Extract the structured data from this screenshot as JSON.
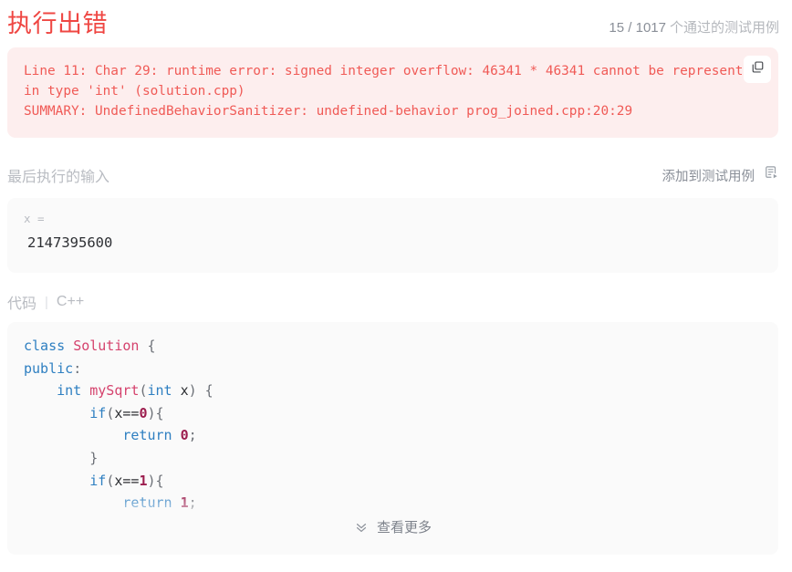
{
  "header": {
    "status_title": "执行出错",
    "passed_count": "15 / 1017",
    "testcase_suffix": "个通过的测试用例"
  },
  "error_panel": {
    "message": "Line 11: Char 29: runtime error: signed integer overflow: 46341 * 46341 cannot be represented in type 'int' (solution.cpp)\nSUMMARY: UndefinedBehaviorSanitizer: undefined-behavior prog_joined.cpp:20:29",
    "copy_icon": "copy-icon",
    "background_color": "#fdeeee",
    "text_color": "#f05a56"
  },
  "input_section": {
    "label": "最后执行的输入",
    "add_testcase_label": "添加到测试用例",
    "add_testcase_icon": "add-to-testcase-icon",
    "variable_name": "x =",
    "variable_value": "2147395600"
  },
  "code_section": {
    "label": "代码",
    "divider": "|",
    "language": "C++",
    "lines": [
      [
        {
          "t": "class ",
          "c": "tok-kw"
        },
        {
          "t": "Solution ",
          "c": "tok-cls"
        },
        {
          "t": "{",
          "c": "tok-punc"
        }
      ],
      [
        {
          "t": "public",
          "c": "tok-kw"
        },
        {
          "t": ":",
          "c": "tok-punc"
        }
      ],
      [
        {
          "t": "    ",
          "c": "tok-id"
        },
        {
          "t": "int ",
          "c": "tok-type"
        },
        {
          "t": "mySqrt",
          "c": "tok-fn"
        },
        {
          "t": "(",
          "c": "tok-punc"
        },
        {
          "t": "int ",
          "c": "tok-type"
        },
        {
          "t": "x",
          "c": "tok-id"
        },
        {
          "t": ") {",
          "c": "tok-punc"
        }
      ],
      [
        {
          "t": "        ",
          "c": "tok-id"
        },
        {
          "t": "if",
          "c": "tok-kw"
        },
        {
          "t": "(",
          "c": "tok-punc"
        },
        {
          "t": "x==",
          "c": "tok-id"
        },
        {
          "t": "0",
          "c": "tok-num"
        },
        {
          "t": "){",
          "c": "tok-punc"
        }
      ],
      [
        {
          "t": "            ",
          "c": "tok-id"
        },
        {
          "t": "return ",
          "c": "tok-kw"
        },
        {
          "t": "0",
          "c": "tok-num"
        },
        {
          "t": ";",
          "c": "tok-punc"
        }
      ],
      [
        {
          "t": "        ",
          "c": "tok-id"
        },
        {
          "t": "}",
          "c": "tok-punc"
        }
      ],
      [
        {
          "t": "        ",
          "c": "tok-id"
        },
        {
          "t": "if",
          "c": "tok-kw"
        },
        {
          "t": "(",
          "c": "tok-punc"
        },
        {
          "t": "x==",
          "c": "tok-id"
        },
        {
          "t": "1",
          "c": "tok-num"
        },
        {
          "t": "){",
          "c": "tok-punc"
        }
      ],
      [
        {
          "t": "            ",
          "c": "tok-id"
        },
        {
          "t": "return ",
          "c": "tok-kw"
        },
        {
          "t": "1",
          "c": "tok-num"
        },
        {
          "t": ";",
          "c": "tok-punc"
        }
      ]
    ],
    "show_more_label": "查看更多",
    "show_more_icon": "double-chevron-down-icon"
  }
}
